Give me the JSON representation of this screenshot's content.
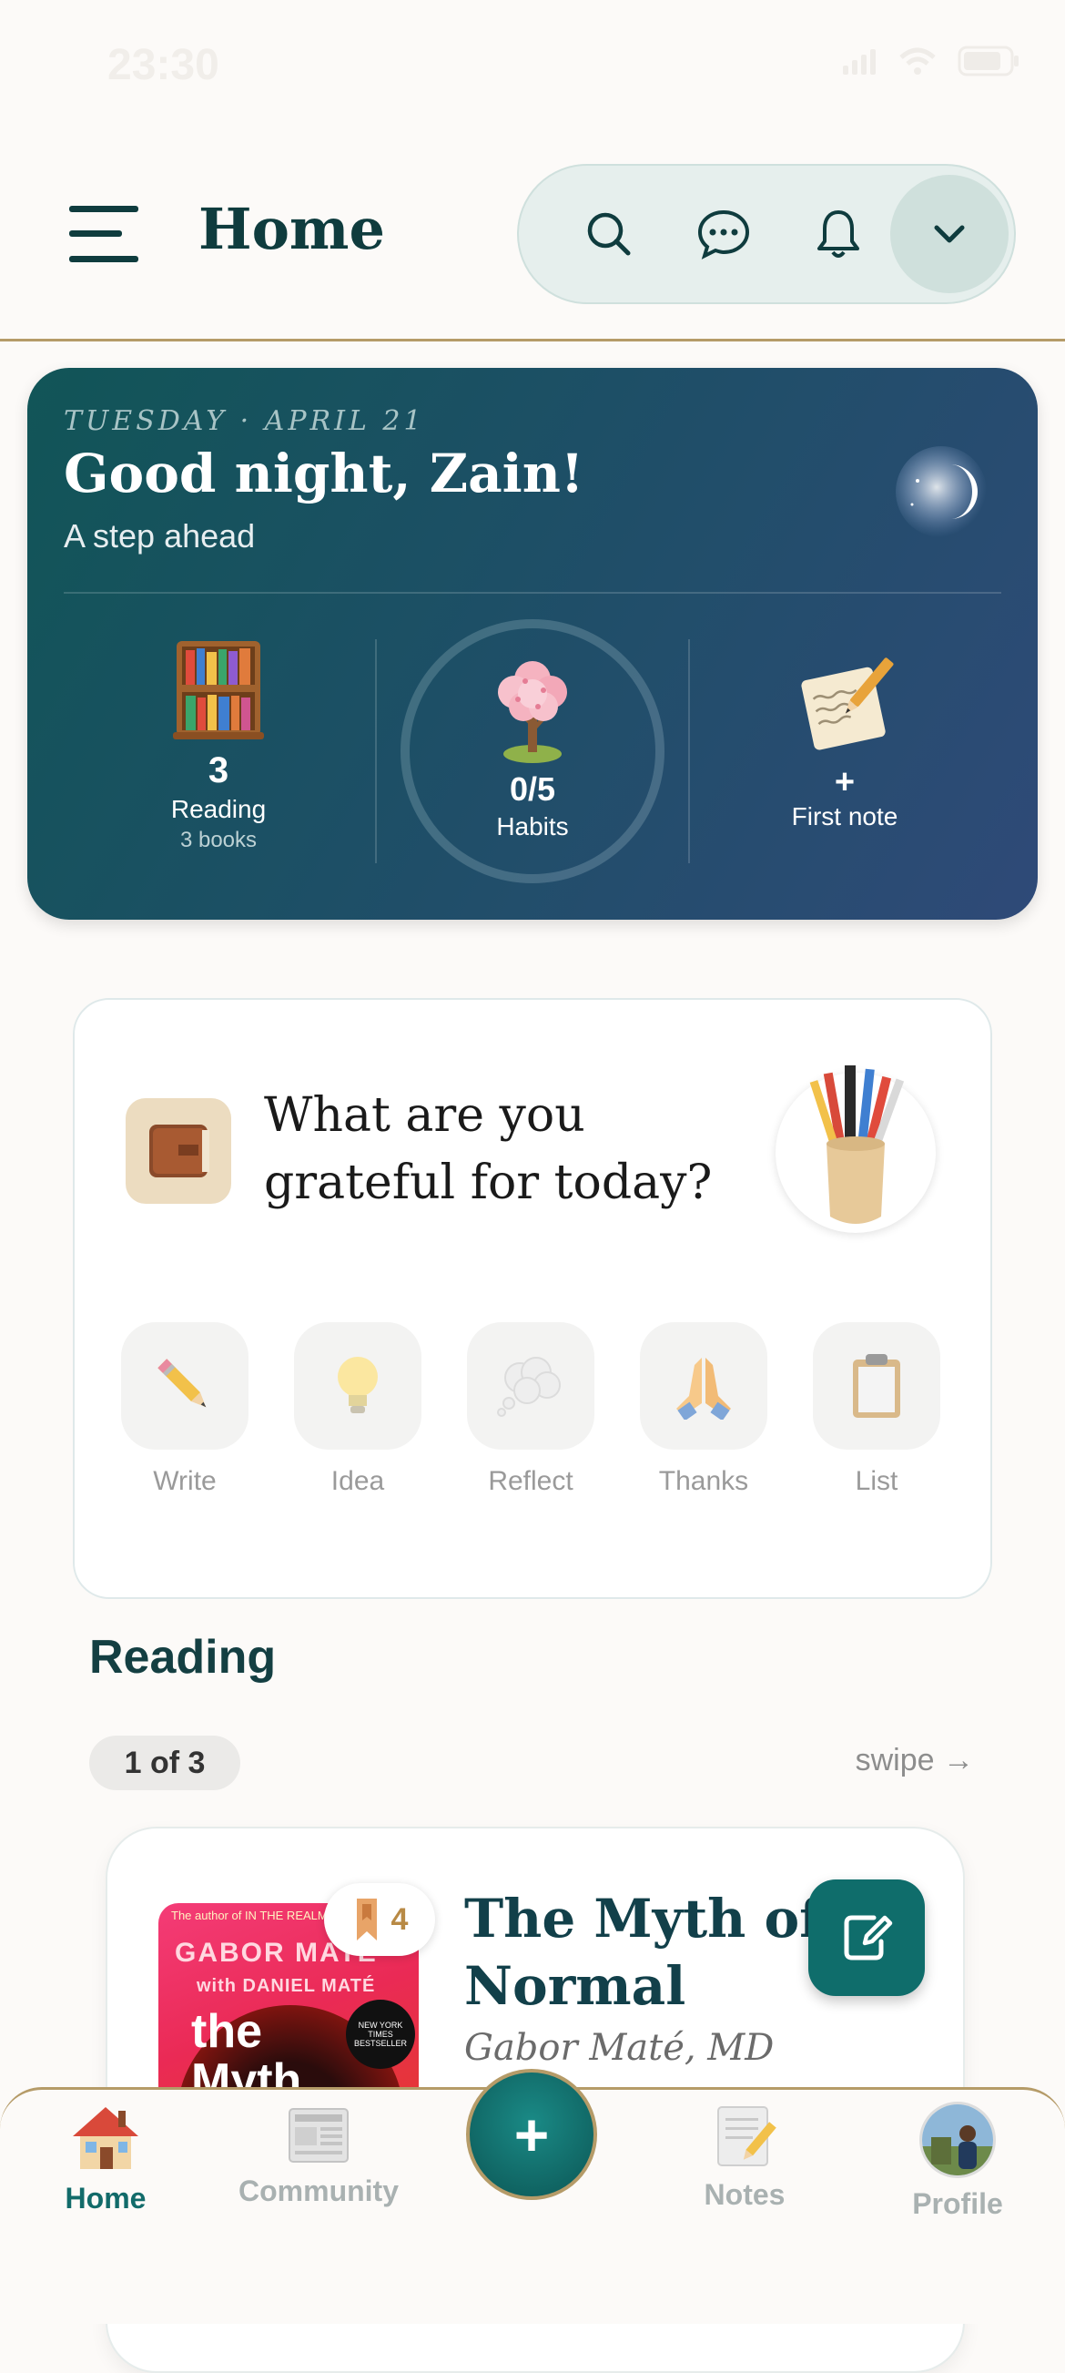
{
  "status_bar": {
    "time": "23:30"
  },
  "header": {
    "title": "Home",
    "icons": [
      "menu-icon",
      "search-icon",
      "chat-icon",
      "bell-icon",
      "chevron-down-icon"
    ]
  },
  "greeting": {
    "date": "TUESDAY · APRIL 21",
    "title": "Good night, Zain!",
    "subtitle": "A step ahead",
    "stats": {
      "reading": {
        "value": "3",
        "label": "Reading",
        "sub": "3 books"
      },
      "habits": {
        "value": "0/5",
        "label": "Habits",
        "progress": 0
      },
      "note": {
        "value": "+",
        "label": "First note"
      }
    }
  },
  "prompt": {
    "text": "What are you grateful for today?",
    "actions": [
      {
        "label": "Write",
        "icon": "pencil-icon"
      },
      {
        "label": "Idea",
        "icon": "lightbulb-icon"
      },
      {
        "label": "Reflect",
        "icon": "thought-bubble-icon"
      },
      {
        "label": "Thanks",
        "icon": "praying-hands-icon"
      },
      {
        "label": "List",
        "icon": "clipboard-icon"
      }
    ]
  },
  "reading": {
    "title": "Reading",
    "counter": "1 of 3",
    "swipe_hint": "swipe →",
    "book": {
      "title": "The Myth of Normal",
      "author": "Gabor Maté, MD",
      "bookmark_count": "4",
      "cover": {
        "top_line": "The author of IN THE REALM OF HUNGRY GHOSTS",
        "author": "GABOR MATÉ",
        "coauthor": "with DANIEL MATÉ",
        "title": "the Myth",
        "badge": "NEW YORK TIMES BESTSELLER"
      }
    }
  },
  "bottom_nav": {
    "items": [
      {
        "label": "Home",
        "icon": "house-icon",
        "active": true
      },
      {
        "label": "Community",
        "icon": "newspaper-icon",
        "active": false
      },
      {
        "label": "+",
        "icon": "plus-icon",
        "active": false
      },
      {
        "label": "Notes",
        "icon": "notes-icon",
        "active": false
      },
      {
        "label": "Profile",
        "icon": "avatar",
        "active": false
      }
    ]
  }
}
